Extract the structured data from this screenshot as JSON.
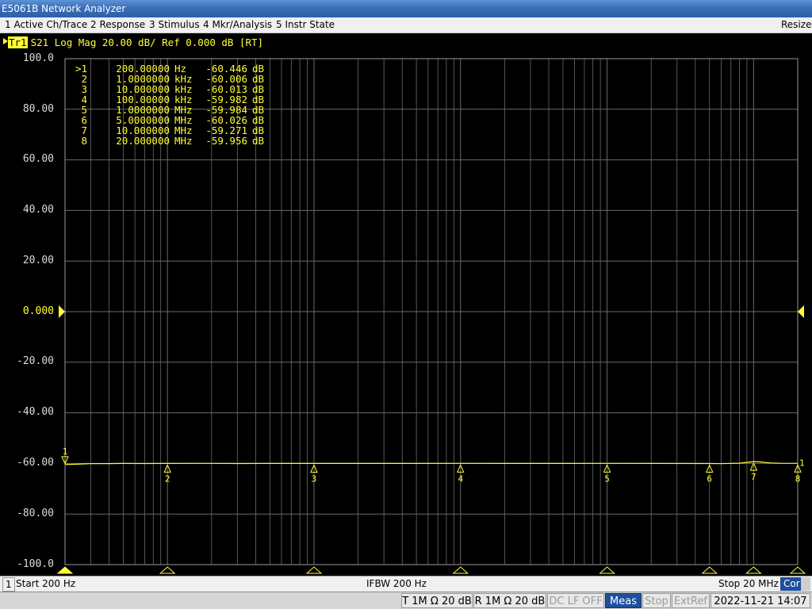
{
  "window": {
    "title": "E5061B Network Analyzer"
  },
  "menu": {
    "items": [
      "1 Active Ch/Trace",
      "2 Response",
      "3 Stimulus",
      "4 Mkr/Analysis",
      "5 Instr State"
    ],
    "resize": "Resize"
  },
  "trace": {
    "name": "Tr1",
    "info": "S21 Log Mag 20.00 dB/ Ref 0.000 dB [RT]"
  },
  "y_axis": {
    "labels": [
      "100.0",
      "80.00",
      "60.00",
      "40.00",
      "20.00",
      "0.000",
      "-20.00",
      "-40.00",
      "-60.00",
      "-80.00",
      "-100.0"
    ]
  },
  "markers": [
    {
      "id": ">1",
      "num": "1",
      "freq": "200.00000",
      "unit": "Hz",
      "value": "-60.446",
      "dunit": "dB"
    },
    {
      "id": "2",
      "num": "2",
      "freq": "1.0000000",
      "unit": "kHz",
      "value": "-60.006",
      "dunit": "dB"
    },
    {
      "id": "3",
      "num": "3",
      "freq": "10.000000",
      "unit": "kHz",
      "value": "-60.013",
      "dunit": "dB"
    },
    {
      "id": "4",
      "num": "4",
      "freq": "100.00000",
      "unit": "kHz",
      "value": "-59.982",
      "dunit": "dB"
    },
    {
      "id": "5",
      "num": "5",
      "freq": "1.0000000",
      "unit": "MHz",
      "value": "-59.984",
      "dunit": "dB"
    },
    {
      "id": "6",
      "num": "6",
      "freq": "5.0000000",
      "unit": "MHz",
      "value": "-60.026",
      "dunit": "dB"
    },
    {
      "id": "7",
      "num": "7",
      "freq": "10.000000",
      "unit": "MHz",
      "value": "-59.271",
      "dunit": "dB"
    },
    {
      "id": "8",
      "num": "8",
      "freq": "20.000000",
      "unit": "MHz",
      "value": "-59.956",
      "dunit": "dB"
    }
  ],
  "trace_end_label": "1",
  "channel": {
    "number": "1",
    "start": "Start 200 Hz",
    "ifbw": "IFBW 200 Hz",
    "stop": "Stop 20 MHz",
    "cor": "Cor"
  },
  "status": {
    "t_input": "T 1M Ω 20 dB",
    "r_input": "R 1M Ω 20 dB",
    "dc_lf": "DC LF OFF",
    "meas": "Meas",
    "stop": "Stop",
    "extref": "ExtRef",
    "datetime": "2022-11-21 14:07"
  },
  "colors": {
    "trace": "#ffff33",
    "grid": "#6a6a6a",
    "background": "#000000",
    "status_active": "#1e4f9e"
  },
  "chart_data": {
    "type": "line",
    "x_scale": "log",
    "xlim_hz": [
      200,
      20000000
    ],
    "ylim": [
      -100,
      100
    ],
    "y_unit": "dB",
    "grid": true,
    "series": [
      {
        "name": "S21",
        "x": [
          200,
          240,
          300,
          400,
          500,
          700,
          1000,
          2000,
          3000,
          5000,
          10000,
          20000,
          50000,
          100000,
          200000,
          500000,
          1000000,
          2000000,
          5000000,
          6000000,
          8000000,
          10000000,
          11000000,
          13000000,
          15000000,
          20000000
        ],
        "y": [
          -60.446,
          -60.3,
          -60.1,
          -60.05,
          -60.0,
          -60.03,
          -60.006,
          -59.98,
          -60.02,
          -60.0,
          -60.013,
          -59.99,
          -60.0,
          -59.982,
          -60.0,
          -59.99,
          -59.984,
          -60.0,
          -60.026,
          -60.1,
          -59.9,
          -59.271,
          -59.4,
          -59.8,
          -59.95,
          -59.956
        ]
      }
    ],
    "markers": [
      {
        "id": 1,
        "x": 200,
        "y": -60.446,
        "label_pos": "above"
      },
      {
        "id": 2,
        "x": 1000,
        "y": -60.006,
        "label_pos": "below"
      },
      {
        "id": 3,
        "x": 10000,
        "y": -60.013,
        "label_pos": "below"
      },
      {
        "id": 4,
        "x": 100000,
        "y": -59.982,
        "label_pos": "below"
      },
      {
        "id": 5,
        "x": 1000000,
        "y": -59.984,
        "label_pos": "below"
      },
      {
        "id": 6,
        "x": 5000000,
        "y": -60.026,
        "label_pos": "below"
      },
      {
        "id": 7,
        "x": 10000000,
        "y": -59.271,
        "label_pos": "below"
      },
      {
        "id": 8,
        "x": 20000000,
        "y": -59.956,
        "label_pos": "below"
      }
    ],
    "reference_level": 0
  }
}
